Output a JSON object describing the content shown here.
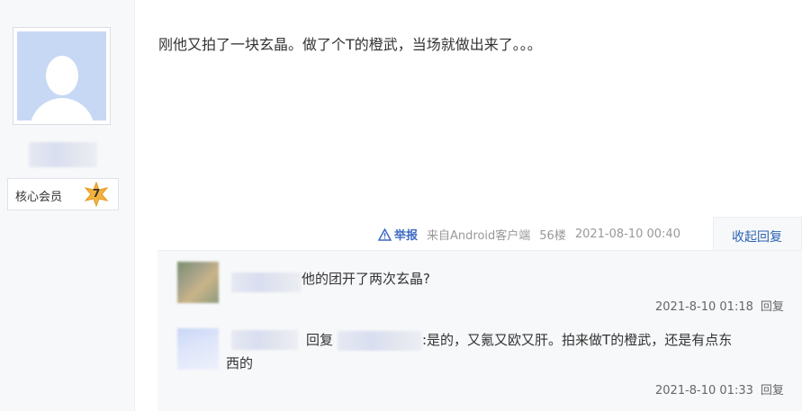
{
  "user": {
    "member_label": "核心会员",
    "level": "7"
  },
  "post": {
    "text": "刚他又拍了一块玄晶。做了个T的橙武，当场就做出来了。。。",
    "report_label": "举报",
    "source": "来自Android客户端",
    "floor": "56楼",
    "datetime": "2021-08-10 00:40",
    "collapse_label": "收起回复"
  },
  "replies": [
    {
      "text": "他的团开了两次玄晶?",
      "datetime": "2021-8-10 01:18",
      "reply_label": "回复"
    },
    {
      "reply_word": "回复",
      "text_line1": ":是的，又氪又欧又肝。拍来做T的橙武，还是有点东",
      "text_line2": "西的",
      "datetime": "2021-8-10 01:33",
      "reply_label": "回复"
    }
  ],
  "colors": {
    "accent": "#2d64b3",
    "avatar_bg": "#c6d8f4",
    "star": "#f4b23c"
  }
}
